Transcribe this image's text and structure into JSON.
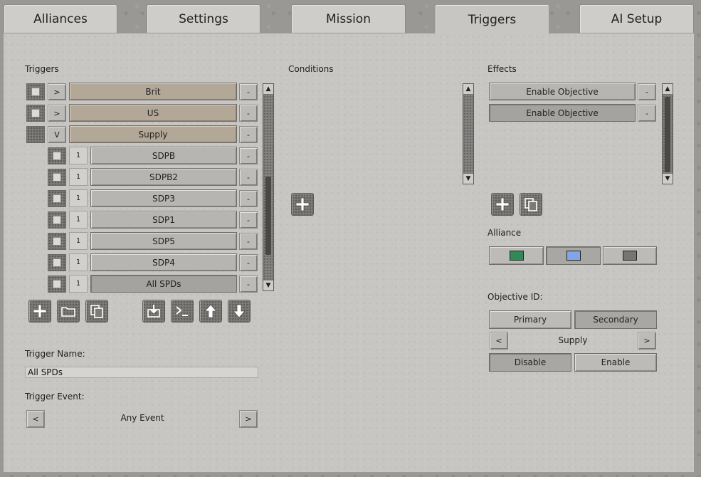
{
  "tabs": [
    {
      "label": "Alliances",
      "active": false
    },
    {
      "label": "Settings",
      "active": false
    },
    {
      "label": "Mission",
      "active": false
    },
    {
      "label": "Triggers",
      "active": true
    },
    {
      "label": "AI Setup",
      "active": false
    }
  ],
  "triggers": {
    "label": "Triggers",
    "groups": [
      {
        "expander": ">",
        "name": "Brit",
        "remove": "-"
      },
      {
        "expander": ">",
        "name": "US",
        "remove": "-"
      },
      {
        "expander": "V",
        "name": "Supply",
        "remove": "-"
      }
    ],
    "items": [
      {
        "count": "1",
        "name": "SDPB",
        "remove": "-"
      },
      {
        "count": "1",
        "name": "SDPB2",
        "remove": "-"
      },
      {
        "count": "1",
        "name": "SDP3",
        "remove": "-"
      },
      {
        "count": "1",
        "name": "SDP1",
        "remove": "-"
      },
      {
        "count": "1",
        "name": "SDP5",
        "remove": "-"
      },
      {
        "count": "1",
        "name": "SDP4",
        "remove": "-"
      },
      {
        "count": "1",
        "name": "All SPDs",
        "remove": "-",
        "selected": true
      }
    ],
    "scroll_up": "▲",
    "scroll_down": "▼",
    "toolbar_icons": [
      "add-icon",
      "folder-icon",
      "copy-icon",
      "import-icon",
      "console-icon",
      "move-up-icon",
      "move-down-icon"
    ],
    "name_label": "Trigger Name:",
    "name_value": "All SPDs",
    "event_label": "Trigger Event:",
    "event_prev": "<",
    "event_value": "Any Event",
    "event_next": ">"
  },
  "conditions": {
    "label": "Conditions",
    "scroll_up": "▲",
    "scroll_down": "▼",
    "add_icon": "add-icon"
  },
  "effects": {
    "label": "Effects",
    "items": [
      {
        "name": "Enable Objective",
        "remove": "-"
      },
      {
        "name": "Enable Objective",
        "remove": "-",
        "selected": true
      }
    ],
    "scroll_up": "▲",
    "scroll_down": "▼",
    "add_icon": "add-icon",
    "copy_icon": "copy-icon",
    "alliance_label": "Alliance",
    "alliances": [
      {
        "color": "#2e8b57"
      },
      {
        "color": "#7ea6e8"
      },
      {
        "color": "#777573"
      }
    ],
    "objective_label": "Objective ID:",
    "primary": "Primary",
    "secondary": "Secondary",
    "obj_prev": "<",
    "obj_value": "Supply",
    "obj_next": ">",
    "disable": "Disable",
    "enable": "Enable"
  }
}
